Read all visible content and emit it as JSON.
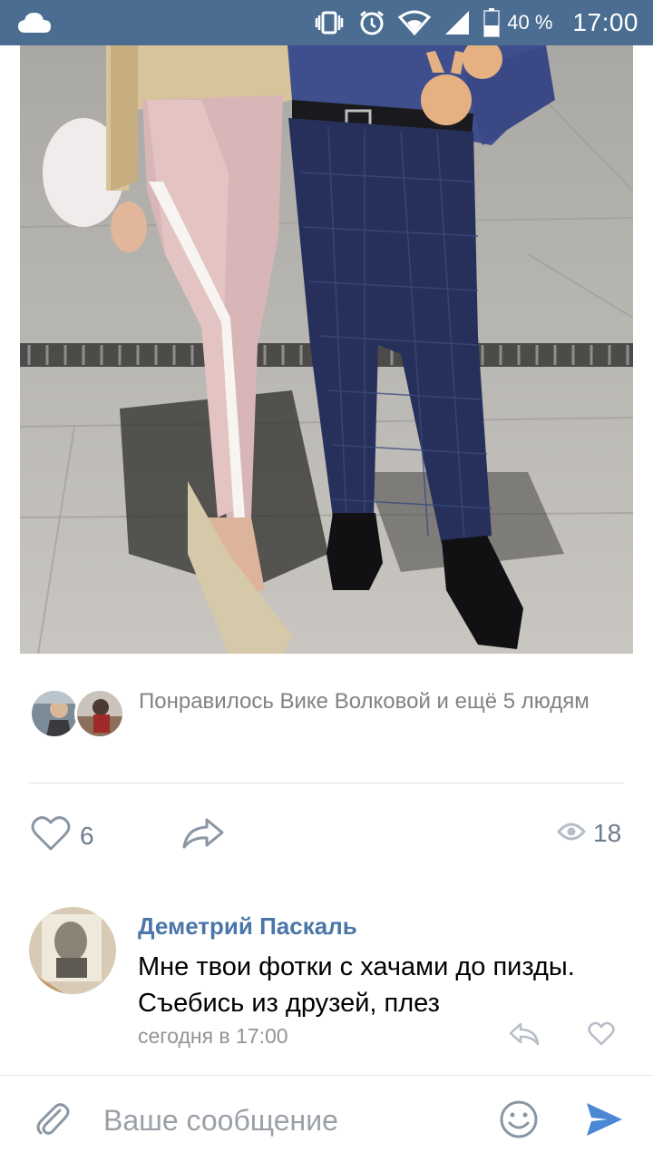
{
  "status_bar": {
    "battery_percent": "40 %",
    "time": "17:00"
  },
  "post": {
    "likes_text": "Понравилось Вике Волковой и ещё 5 людям",
    "like_count": "6",
    "views_count": "18"
  },
  "comment": {
    "author": "Деметрий Паскаль",
    "text": "Мне твои фотки с хачами до пизды. Съебись из друзей, плез",
    "time": "сегодня в 17:00"
  },
  "composer": {
    "placeholder": "Ваше сообщение"
  },
  "colors": {
    "status_bar": "#4a6d91",
    "accent": "#4a76a8",
    "send": "#4a87d4",
    "icon_gray": "#8a96a3"
  }
}
